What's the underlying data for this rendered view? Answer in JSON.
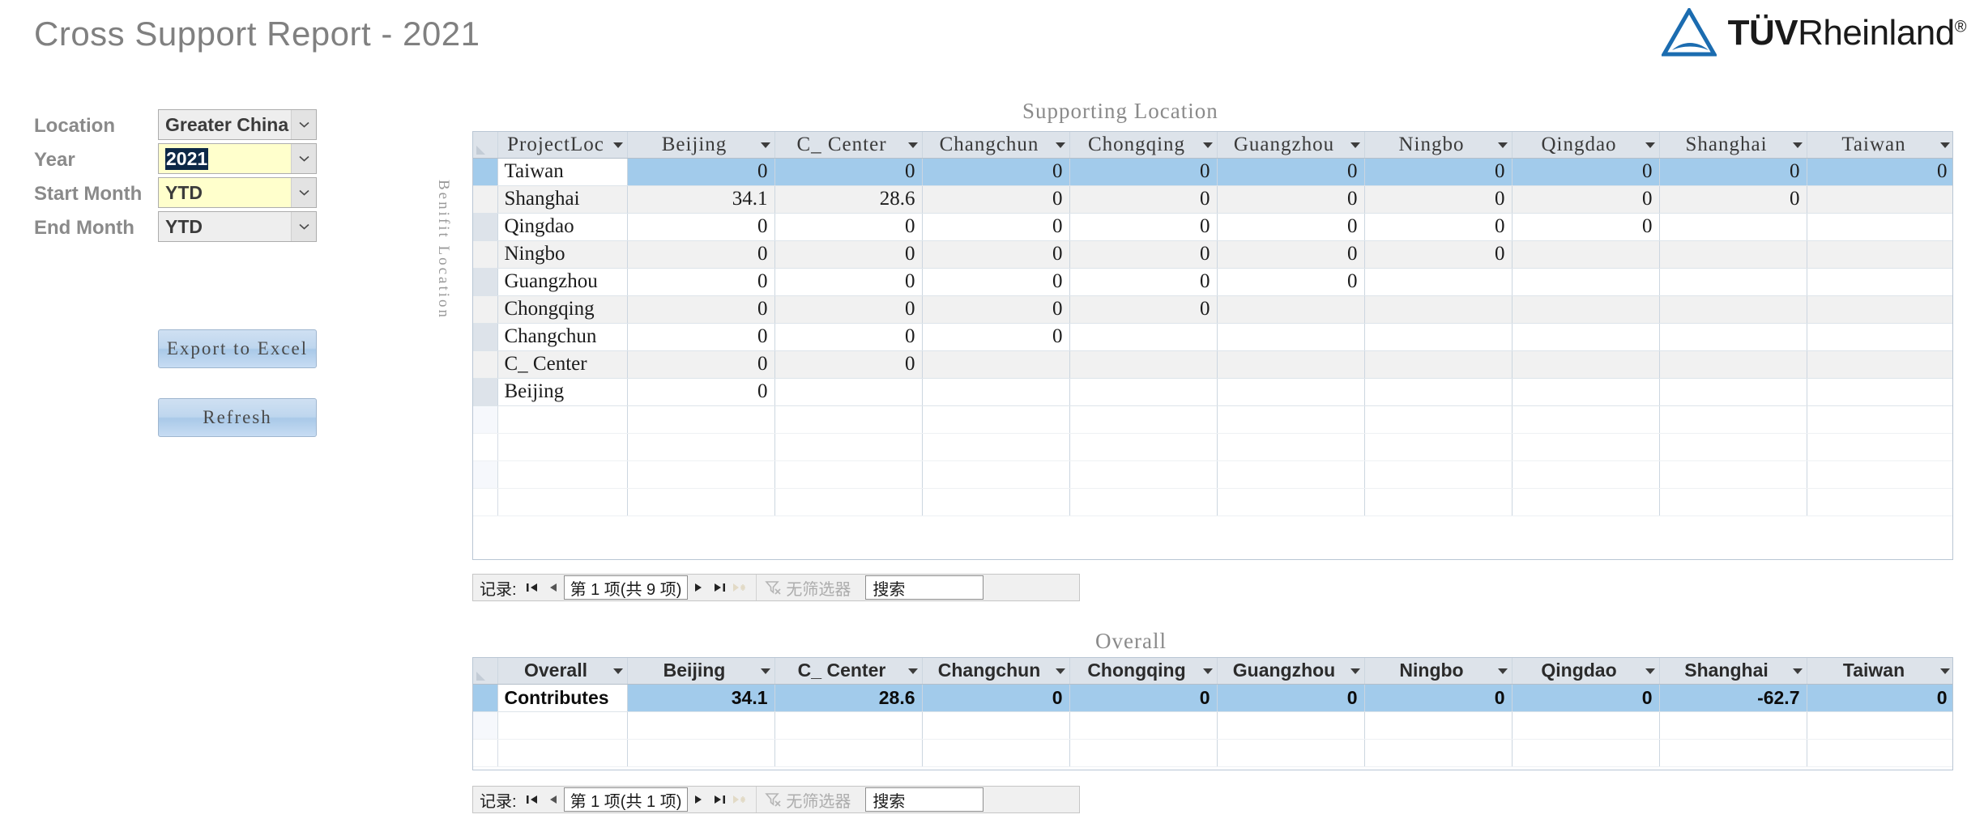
{
  "header": {
    "title": "Cross Support Report - 2021",
    "logo": {
      "brand_bold": "TÜV",
      "brand_rest": "Rheinland",
      "registered": "®",
      "color": "#1b6cb0"
    }
  },
  "form": {
    "fields": [
      {
        "label": "Location",
        "value": "Greater China",
        "highlighted": false,
        "selected_text": ""
      },
      {
        "label": "Year",
        "value": "2021",
        "highlighted": true,
        "selected_text": "2021"
      },
      {
        "label": "Start Month",
        "value": "YTD",
        "highlighted": true,
        "selected_text": ""
      },
      {
        "label": "End Month",
        "value": "YTD",
        "highlighted": false,
        "selected_text": ""
      }
    ],
    "buttons": [
      {
        "label": "Export to Excel"
      },
      {
        "label": "Refresh"
      }
    ]
  },
  "supporting": {
    "title": "Supporting Location",
    "axis_label": "Benifit Location",
    "columns": [
      "ProjectLoc",
      "Beijing",
      "C_ Center",
      "Changchun",
      "Chongqing",
      "Guangzhou",
      "Ningbo",
      "Qingdao",
      "Shanghai",
      "Taiwan"
    ],
    "rows": [
      {
        "name": "Taiwan",
        "values": [
          "0",
          "0",
          "0",
          "0",
          "0",
          "0",
          "0",
          "0",
          "0"
        ],
        "selected": true
      },
      {
        "name": "Shanghai",
        "values": [
          "34.1",
          "28.6",
          "0",
          "0",
          "0",
          "0",
          "0",
          "0",
          ""
        ],
        "selected": false
      },
      {
        "name": "Qingdao",
        "values": [
          "0",
          "0",
          "0",
          "0",
          "0",
          "0",
          "0",
          "",
          ""
        ],
        "selected": false
      },
      {
        "name": "Ningbo",
        "values": [
          "0",
          "0",
          "0",
          "0",
          "0",
          "0",
          "",
          "",
          ""
        ],
        "selected": false
      },
      {
        "name": "Guangzhou",
        "values": [
          "0",
          "0",
          "0",
          "0",
          "0",
          "",
          "",
          "",
          ""
        ],
        "selected": false
      },
      {
        "name": "Chongqing",
        "values": [
          "0",
          "0",
          "0",
          "0",
          "",
          "",
          "",
          "",
          ""
        ],
        "selected": false
      },
      {
        "name": "Changchun",
        "values": [
          "0",
          "0",
          "0",
          "",
          "",
          "",
          "",
          "",
          ""
        ],
        "selected": false
      },
      {
        "name": "C_ Center",
        "values": [
          "0",
          "0",
          "",
          "",
          "",
          "",
          "",
          "",
          ""
        ],
        "selected": false
      },
      {
        "name": "Beijing",
        "values": [
          "0",
          "",
          "",
          "",
          "",
          "",
          "",
          "",
          ""
        ],
        "selected": false
      }
    ],
    "blank_rows": 4,
    "nav": {
      "record_label": "记录:",
      "position": "第 1 项(共 9 项)",
      "filter_label": "无筛选器",
      "search_placeholder": "搜索"
    }
  },
  "overall": {
    "title": "Overall",
    "columns": [
      "Overall",
      "Beijing",
      "C_ Center",
      "Changchun",
      "Chongqing",
      "Guangzhou",
      "Ningbo",
      "Qingdao",
      "Shanghai",
      "Taiwan"
    ],
    "rows": [
      {
        "name": "Contributes",
        "values": [
          "34.1",
          "28.6",
          "0",
          "0",
          "0",
          "0",
          "0",
          "-62.7",
          "0"
        ],
        "selected": true
      }
    ],
    "blank_rows": 2,
    "nav": {
      "record_label": "记录:",
      "position": "第 1 项(共 1 项)",
      "filter_label": "无筛选器",
      "search_placeholder": "搜索"
    }
  },
  "colors": {
    "title_gray": "#808080",
    "selection_blue": "#a2cbeb",
    "header_gray": "#dde3ea",
    "highlight_yellow": "#ffffcc",
    "brand_blue": "#1b6cb0"
  }
}
